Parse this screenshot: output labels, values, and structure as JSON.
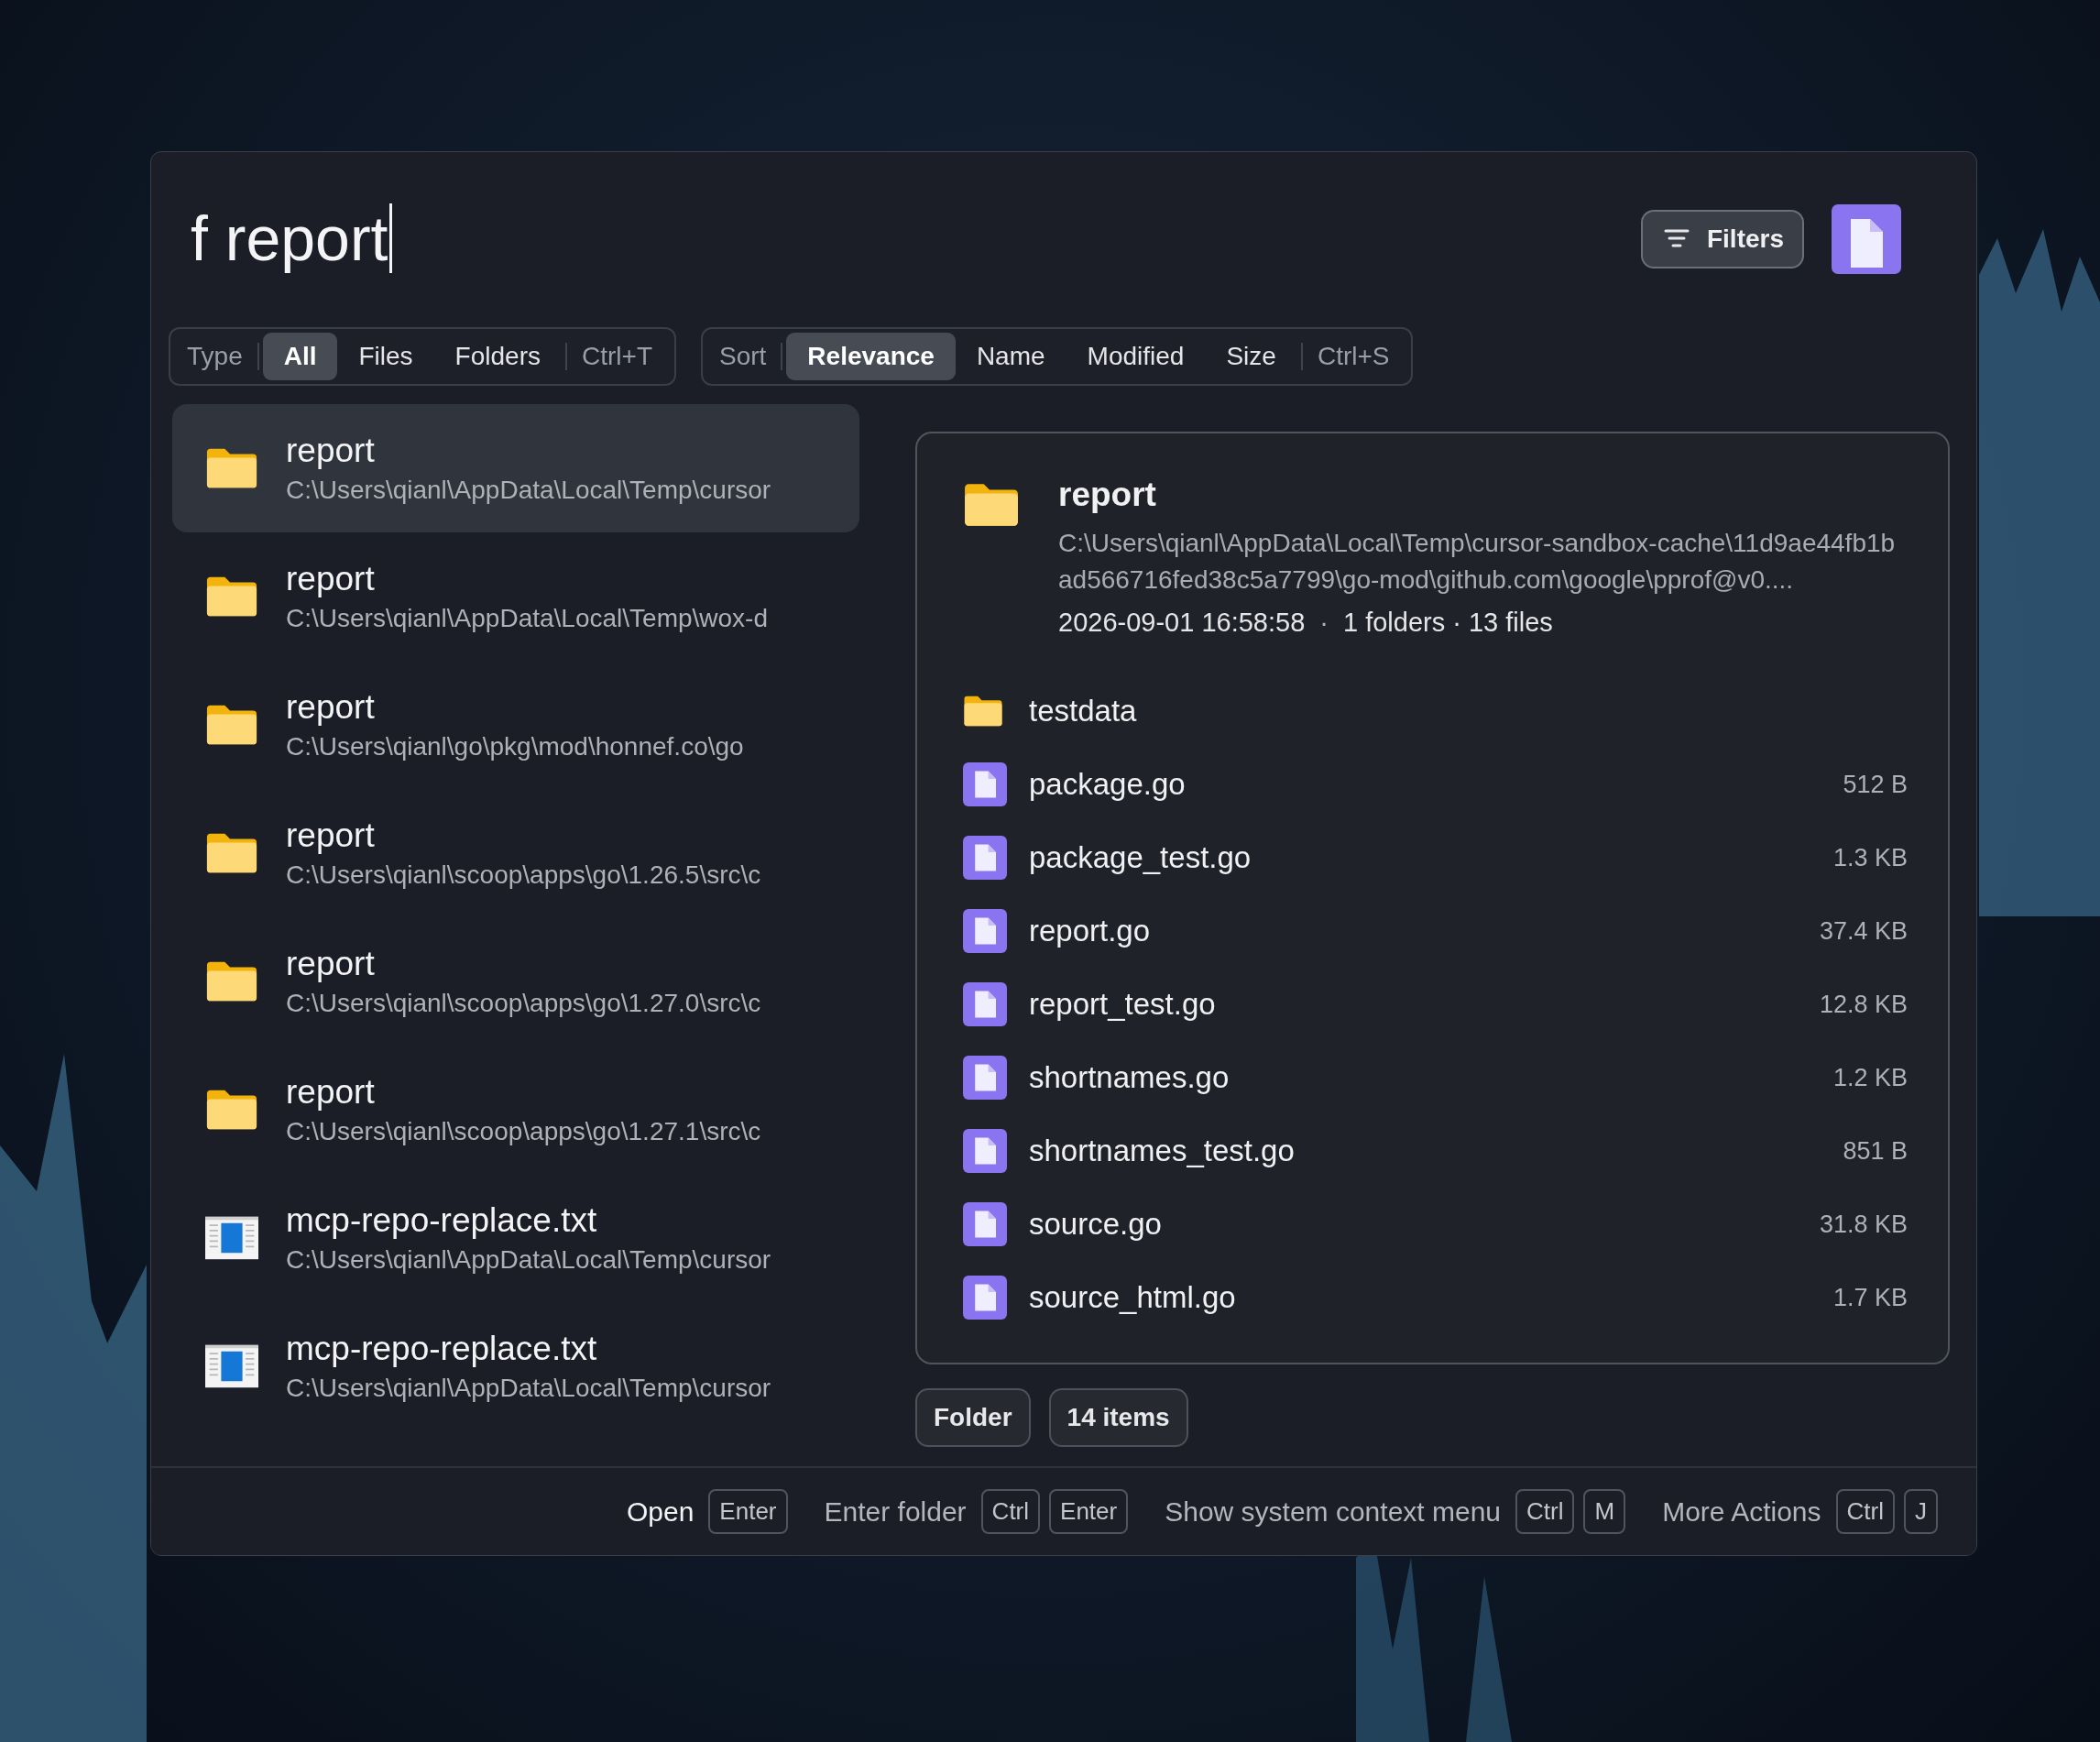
{
  "search": {
    "value": "f report"
  },
  "filters_button": {
    "label": "Filters"
  },
  "type_filter": {
    "label": "Type",
    "options": [
      {
        "label": "All",
        "selected": true
      },
      {
        "label": "Files",
        "selected": false
      },
      {
        "label": "Folders",
        "selected": false
      }
    ],
    "shortcut": "Ctrl+T"
  },
  "sort": {
    "label": "Sort",
    "options": [
      {
        "label": "Relevance",
        "selected": true
      },
      {
        "label": "Name",
        "selected": false
      },
      {
        "label": "Modified",
        "selected": false
      },
      {
        "label": "Size",
        "selected": false
      }
    ],
    "shortcut": "Ctrl+S"
  },
  "results": [
    {
      "kind": "folder",
      "title": "report",
      "path": "C:\\Users\\qianl\\AppData\\Local\\Temp\\cursor",
      "selected": true
    },
    {
      "kind": "folder",
      "title": "report",
      "path": "C:\\Users\\qianl\\AppData\\Local\\Temp\\wox-d",
      "selected": false
    },
    {
      "kind": "folder",
      "title": "report",
      "path": "C:\\Users\\qianl\\go\\pkg\\mod\\honnef.co\\go",
      "selected": false
    },
    {
      "kind": "folder",
      "title": "report",
      "path": "C:\\Users\\qianl\\scoop\\apps\\go\\1.26.5\\src\\c",
      "selected": false
    },
    {
      "kind": "folder",
      "title": "report",
      "path": "C:\\Users\\qianl\\scoop\\apps\\go\\1.27.0\\src\\c",
      "selected": false
    },
    {
      "kind": "folder",
      "title": "report",
      "path": "C:\\Users\\qianl\\scoop\\apps\\go\\1.27.1\\src\\c",
      "selected": false
    },
    {
      "kind": "text",
      "title": "mcp-repo-replace.txt",
      "path": "C:\\Users\\qianl\\AppData\\Local\\Temp\\cursor",
      "selected": false
    },
    {
      "kind": "text",
      "title": "mcp-repo-replace.txt",
      "path": "C:\\Users\\qianl\\AppData\\Local\\Temp\\cursor",
      "selected": false
    }
  ],
  "preview": {
    "kind": "folder",
    "title": "report",
    "path": "C:\\Users\\qianl\\AppData\\Local\\Temp\\cursor-sandbox-cache\\11d9ae44fb1bad566716fed38c5a7799\\go-mod\\github.com\\google\\pprof@v0....",
    "modified": "2026-09-01 16:58:58",
    "separator": "·",
    "summary": "1 folders · 13 files",
    "children": [
      {
        "kind": "folder",
        "name": "testdata"
      },
      {
        "kind": "file",
        "name": "package.go",
        "size": "512 B"
      },
      {
        "kind": "file",
        "name": "package_test.go",
        "size": "1.3 KB"
      },
      {
        "kind": "file",
        "name": "report.go",
        "size": "37.4 KB"
      },
      {
        "kind": "file",
        "name": "report_test.go",
        "size": "12.8 KB"
      },
      {
        "kind": "file",
        "name": "shortnames.go",
        "size": "1.2 KB"
      },
      {
        "kind": "file",
        "name": "shortnames_test.go",
        "size": "851 B"
      },
      {
        "kind": "file",
        "name": "source.go",
        "size": "31.8 KB"
      },
      {
        "kind": "file",
        "name": "source_html.go",
        "size": "1.7 KB"
      }
    ]
  },
  "tags": [
    "Folder",
    "14 items"
  ],
  "actions": [
    {
      "label": "Open",
      "keys": [
        "Enter"
      ],
      "primary": true
    },
    {
      "label": "Enter folder",
      "keys": [
        "Ctrl",
        "Enter"
      ],
      "primary": false
    },
    {
      "label": "Show system context menu",
      "keys": [
        "Ctrl",
        "M"
      ],
      "primary": false
    },
    {
      "label": "More Actions",
      "keys": [
        "Ctrl",
        "J"
      ],
      "primary": false
    }
  ]
}
